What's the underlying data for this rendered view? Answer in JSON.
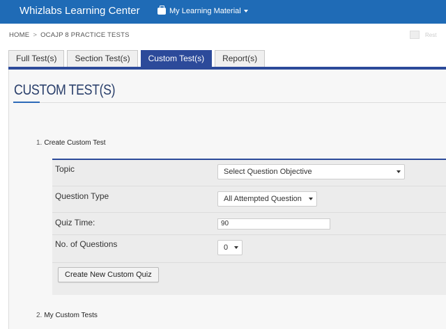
{
  "header": {
    "brand": "Whizlabs Learning Center",
    "menu_label": "My Learning Material"
  },
  "breadcrumb": {
    "home": "HOME",
    "separator": ">",
    "current": "OCAJP 8 PRACTICE TESTS"
  },
  "toolbar": {
    "faded_label": "Rest"
  },
  "tabs": [
    {
      "label": "Full Test(s)",
      "active": false
    },
    {
      "label": "Section Test(s)",
      "active": false
    },
    {
      "label": "Custom Test(s)",
      "active": true
    },
    {
      "label": "Report(s)",
      "active": false
    }
  ],
  "page": {
    "title": "CUSTOM TEST(S)"
  },
  "sections": {
    "create": {
      "number": "1.",
      "label": "Create Custom Test"
    },
    "mine": {
      "number": "2.",
      "label": "My Custom Tests"
    }
  },
  "form": {
    "topic": {
      "label": "Topic",
      "value": "Select Question Objective"
    },
    "question_type": {
      "label": "Question Type",
      "value": "All Attempted Question"
    },
    "quiz_time": {
      "label": "Quiz Time:",
      "value": "90"
    },
    "num_questions": {
      "label": "No. of Questions",
      "value": "0"
    },
    "submit_label": "Create New Custom Quiz"
  },
  "colors": {
    "topbar": "#1f6bb6",
    "tab_active": "#2c4a9a",
    "title": "#2a3f6b"
  }
}
